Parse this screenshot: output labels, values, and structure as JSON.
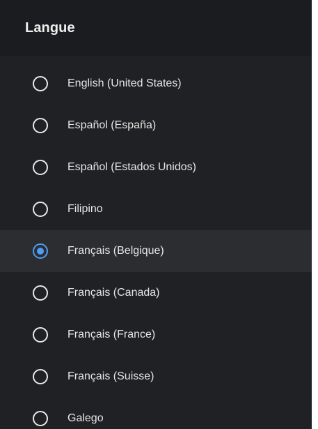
{
  "dialog": {
    "title": "Langue"
  },
  "languages": [
    {
      "label": "English (United States)",
      "selected": false
    },
    {
      "label": "Español (España)",
      "selected": false
    },
    {
      "label": "Español (Estados Unidos)",
      "selected": false
    },
    {
      "label": "Filipino",
      "selected": false
    },
    {
      "label": "Français (Belgique)",
      "selected": true
    },
    {
      "label": "Français (Canada)",
      "selected": false
    },
    {
      "label": "Français (France)",
      "selected": false
    },
    {
      "label": "Français (Suisse)",
      "selected": false
    },
    {
      "label": "Galego",
      "selected": false
    }
  ],
  "colors": {
    "background": "#202124",
    "header": "#1b1c1f",
    "selected_row": "#2c2d31",
    "accent": "#4d9df4",
    "text": "#e6e6e6"
  },
  "icons": {
    "radio_unchecked": "radio-unchecked-icon",
    "radio_checked": "radio-checked-icon"
  }
}
